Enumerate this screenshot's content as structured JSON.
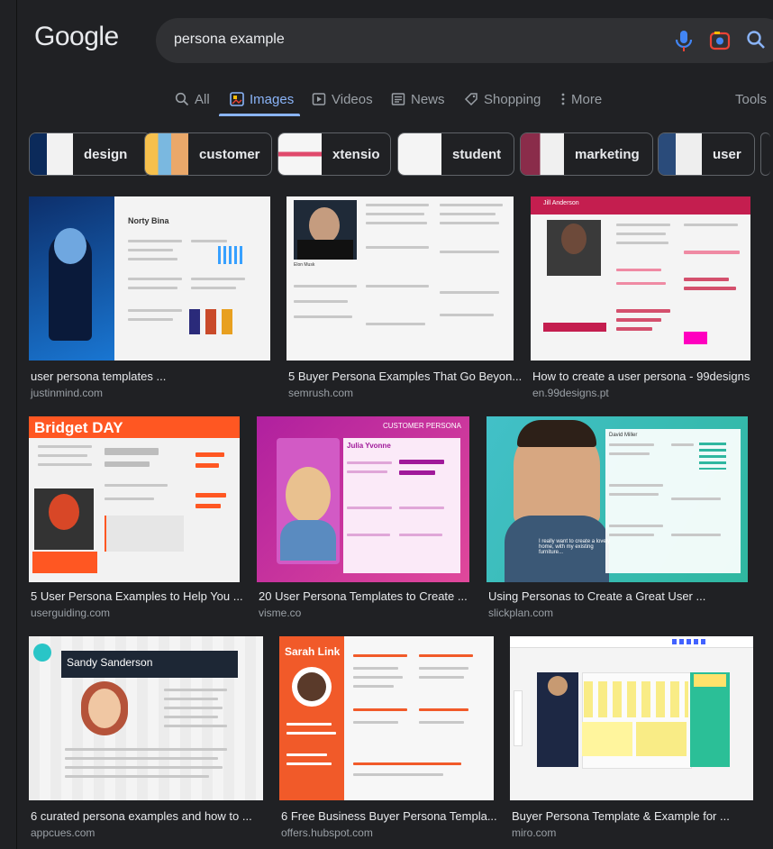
{
  "header": {
    "logo": "Google",
    "query": "persona example"
  },
  "tabs": [
    {
      "label": "All",
      "icon": "search-icon"
    },
    {
      "label": "Images",
      "icon": "image-icon",
      "active": true
    },
    {
      "label": "Videos",
      "icon": "play-icon"
    },
    {
      "label": "News",
      "icon": "news-icon"
    },
    {
      "label": "Shopping",
      "icon": "tag-icon"
    },
    {
      "label": "More",
      "icon": "more-vert-icon"
    },
    {
      "label": "Tools"
    }
  ],
  "chips": [
    "design",
    "customer",
    "xtensio",
    "student",
    "marketing",
    "user"
  ],
  "results": [
    {
      "title": "user persona templates ...",
      "source": "justinmind.com"
    },
    {
      "title": "5 Buyer Persona Examples That Go Beyon...",
      "source": "semrush.com"
    },
    {
      "title": "How to create a user persona - 99designs",
      "source": "en.99designs.pt"
    },
    {
      "title": "5 User Persona Examples to Help You ...",
      "source": "userguiding.com"
    },
    {
      "title": "20 User Persona Templates to Create ...",
      "source": "visme.co"
    },
    {
      "title": "Using Personas to Create a Great User ...",
      "source": "slickplan.com"
    },
    {
      "title": "6 curated persona examples and how to ...",
      "source": "appcues.com"
    },
    {
      "title": "6 Free Business Buyer Persona Templa...",
      "source": "offers.hubspot.com"
    },
    {
      "title": "Buyer Persona Template & Example for ...",
      "source": "miro.com"
    }
  ],
  "image_text": {
    "r1c1_name": "Norty Bina",
    "r1c2_name": "Elon Musk",
    "r1c3_name": "Jill Anderson",
    "r2c1_name": "Bridget DAY",
    "r2c2_header": "CUSTOMER PERSONA",
    "r2c2_name": "Julia Yvonne",
    "r2c3_name": "David Miller",
    "r2c3_quote": "I really want to create a lovely home, with my existing furniture...",
    "r3c1_name": "Sandy Sanderson",
    "r3c2_name": "Sarah Link"
  },
  "colors": {
    "background": "#202124",
    "accent": "#8ab4f8",
    "search_bg": "#303134",
    "muted_text": "#9aa0a6"
  }
}
